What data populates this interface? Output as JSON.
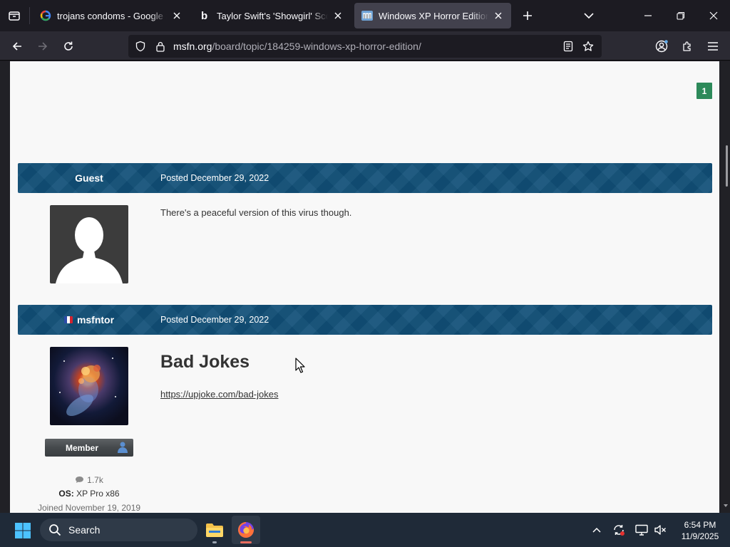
{
  "browser": {
    "tabs": [
      {
        "title": "trojans condoms - Google Search",
        "active": false
      },
      {
        "title": "Taylor Swift's 'Showgirl' Scores |",
        "active": false
      },
      {
        "title": "Windows XP Horror Edition - MSFN",
        "active": true
      }
    ],
    "url": {
      "domain": "msfn.org",
      "path": "/board/topic/184259-windows-xp-horror-edition/"
    }
  },
  "page": {
    "reputation_badge": "1",
    "posts": [
      {
        "author": "Guest",
        "posted": "Posted December 29, 2022",
        "body": "There's a peaceful version of this virus though."
      },
      {
        "author": "msfntor",
        "posted": "Posted December 29, 2022",
        "title": "Bad Jokes",
        "link": "https://upjoke.com/bad-jokes",
        "rank_badge": "Member",
        "posts_count": "1.7k",
        "os_label": "OS:",
        "os_value": "XP Pro x86",
        "joined": "Joined November 19, 2019"
      }
    ]
  },
  "taskbar": {
    "search_label": "Search",
    "time": "6:54 PM",
    "date": "11/9/2025"
  },
  "colors": {
    "post_header": "#114f78",
    "rep_badge": "#2d8a5a",
    "content_bg": "#f8f8f8",
    "browser_bg": "#1c1b22"
  }
}
